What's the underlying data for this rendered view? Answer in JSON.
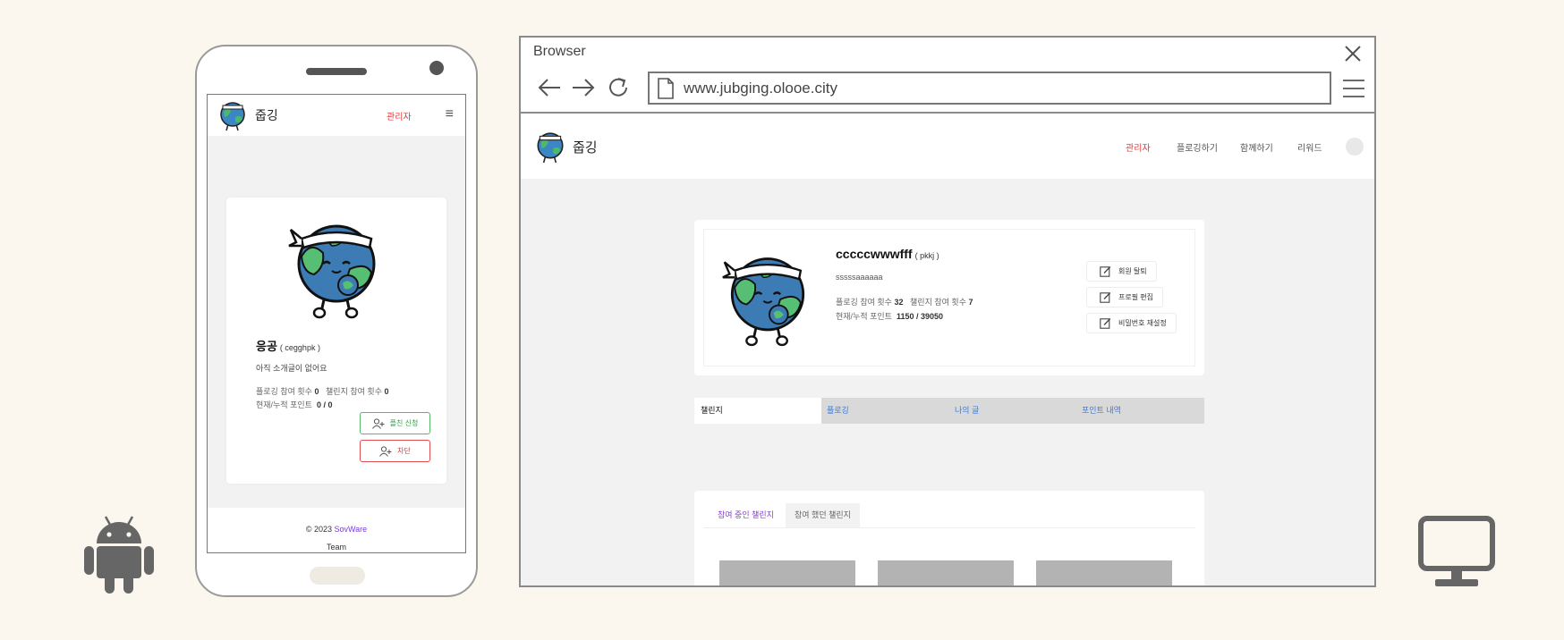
{
  "phone": {
    "brand": "줍깅",
    "admin_label": "관리자",
    "menu_icon": "≡",
    "profile": {
      "name": "응공",
      "id": "( cegghpk )",
      "intro": "아직 소개글이 없어요",
      "plogging_label": "플로깅 참여 횟수",
      "plogging_count": "0",
      "challenge_label": "챌린지 참여 횟수",
      "challenge_count": "0",
      "points_label": "현재/누적 포인트",
      "points": "0 / 0"
    },
    "buttons": {
      "crew": "플친 신청",
      "block": "차단"
    },
    "footer": {
      "copyright": "© 2023",
      "company": "SovWare",
      "team": "Team"
    }
  },
  "browser": {
    "title": "Browser",
    "url": "www.jubging.olooe.city",
    "site": {
      "brand": "줍깅",
      "nav": [
        "관리자",
        "플로깅하기",
        "함께하기",
        "리워드"
      ],
      "profile": {
        "name": "cccccwwwfff",
        "id": "( pkkj )",
        "intro": "sssssaaaaaa",
        "plogging_label": "플로깅 참여 횟수",
        "plogging_count": "32",
        "challenge_label": "챌린지 참여 횟수",
        "challenge_count": "7",
        "points_label": "현재/누적 포인트",
        "points": "1150 / 39050"
      },
      "actions": [
        "회원 탈퇴",
        "프로필 편집",
        "비밀번호 재설정"
      ],
      "tabs": [
        "챌린지",
        "플로깅",
        "나의 글",
        "포인트 내역"
      ],
      "challenge_tabs": [
        "참여 중인 챌린지",
        "참여 했던 챌린지"
      ]
    }
  },
  "colors": {
    "background": "#fcf7ee",
    "admin": "#e23b3b",
    "accent_purple": "#8a3fd0",
    "tab_blue": "#3a7be0",
    "green_button": "#56b86a",
    "red_button": "#e05050"
  }
}
